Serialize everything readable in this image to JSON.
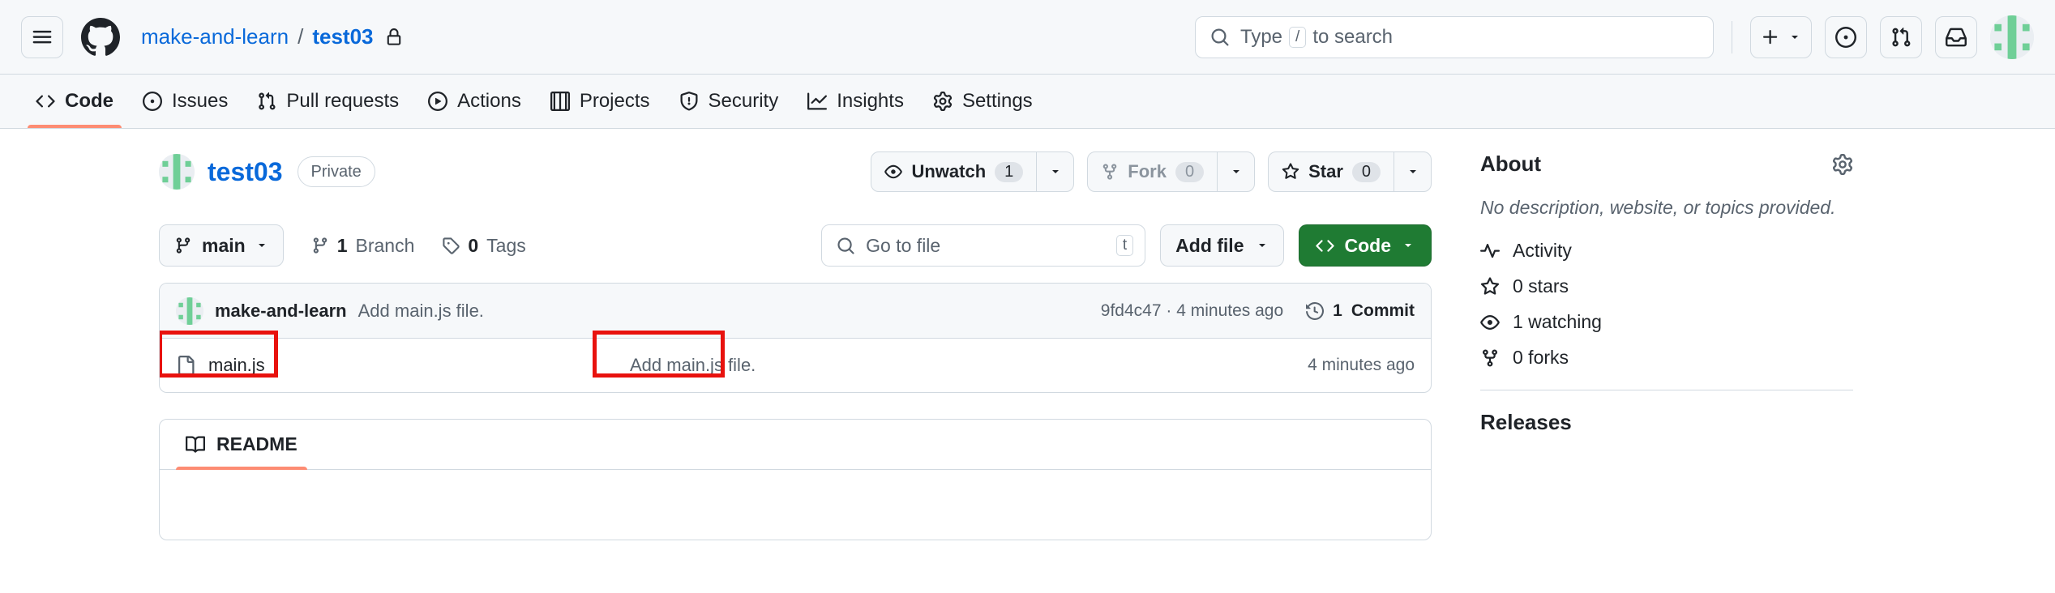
{
  "header": {
    "menu_icon": "hamburger-icon",
    "logo_icon": "github-logo-icon",
    "owner": "make-and-learn",
    "separator": "/",
    "repo": "test03",
    "lock_icon": "lock-icon",
    "search": {
      "icon": "search-icon",
      "text_before": "Type",
      "kbd": "/",
      "text_after": "to search"
    },
    "actions": {
      "create_new_icon": "plus-icon",
      "create_new_caret": "chevron-down-icon",
      "issues_icon": "issue-opened-icon",
      "pull_requests_icon": "git-pull-request-icon",
      "inbox_icon": "inbox-icon",
      "avatar": "user-avatar"
    }
  },
  "repo_nav": {
    "tabs": [
      {
        "label": "Code",
        "icon": "code-icon",
        "active": true
      },
      {
        "label": "Issues",
        "icon": "issue-opened-icon",
        "active": false
      },
      {
        "label": "Pull requests",
        "icon": "git-pull-request-icon",
        "active": false
      },
      {
        "label": "Actions",
        "icon": "play-icon",
        "active": false
      },
      {
        "label": "Projects",
        "icon": "table-icon",
        "active": false
      },
      {
        "label": "Security",
        "icon": "shield-icon",
        "active": false
      },
      {
        "label": "Insights",
        "icon": "graph-icon",
        "active": false
      },
      {
        "label": "Settings",
        "icon": "gear-icon",
        "active": false
      }
    ]
  },
  "repo_header": {
    "avatar": "owner-avatar",
    "name": "test03",
    "visibility": "Private",
    "watch": {
      "icon": "eye-icon",
      "label": "Unwatch",
      "count": "1",
      "caret": "chevron-down-icon"
    },
    "fork": {
      "icon": "repo-forked-icon",
      "label": "Fork",
      "count": "0",
      "caret": "chevron-down-icon"
    },
    "star": {
      "icon": "star-icon",
      "label": "Star",
      "count": "0",
      "caret": "chevron-down-icon"
    }
  },
  "toolbar": {
    "branch": {
      "icon": "git-branch-icon",
      "name": "main",
      "caret": "chevron-down-icon"
    },
    "branches": {
      "icon": "git-branch-icon",
      "count": "1",
      "label": "Branch"
    },
    "tags": {
      "icon": "tag-icon",
      "count": "0",
      "label": "Tags"
    },
    "go_to_file": {
      "icon": "search-icon",
      "placeholder": "Go to file",
      "kbd": "t"
    },
    "add_file": {
      "label": "Add file",
      "caret": "chevron-down-icon"
    },
    "code_button": {
      "icon": "code-icon",
      "label": "Code",
      "caret": "chevron-down-icon"
    }
  },
  "latest_commit": {
    "avatar": "author-avatar",
    "author": "make-and-learn",
    "message": "Add main.js file.",
    "hash": "9fd4c47",
    "dot": "·",
    "time": "4 minutes ago",
    "history_icon": "history-icon",
    "commits_count": "1",
    "commits_label": "Commit"
  },
  "files": [
    {
      "icon": "file-icon",
      "name": "main.js",
      "message": "Add main.js file.",
      "time": "4 minutes ago",
      "highlight_name": true,
      "highlight_message": true
    }
  ],
  "readme": {
    "icon": "book-icon",
    "tab_label": "README"
  },
  "about": {
    "title": "About",
    "settings_icon": "gear-icon",
    "description": "No description, website, or topics provided.",
    "items": [
      {
        "icon": "pulse-icon",
        "label": "Activity"
      },
      {
        "icon": "star-icon",
        "label": "0 stars"
      },
      {
        "icon": "eye-icon",
        "label": "1 watching"
      },
      {
        "icon": "repo-forked-icon",
        "label": "0 forks"
      }
    ],
    "next_section": "Releases"
  },
  "colors": {
    "accent_green": "#1f7b33",
    "link_blue": "#0969da",
    "active_underline": "#fd8c73",
    "annotation_red": "#e8120e",
    "muted_text": "#59636e",
    "border": "#d1d9e0",
    "canvas_subtle": "#f6f8fa",
    "identicon_green": "#6fcf97"
  }
}
